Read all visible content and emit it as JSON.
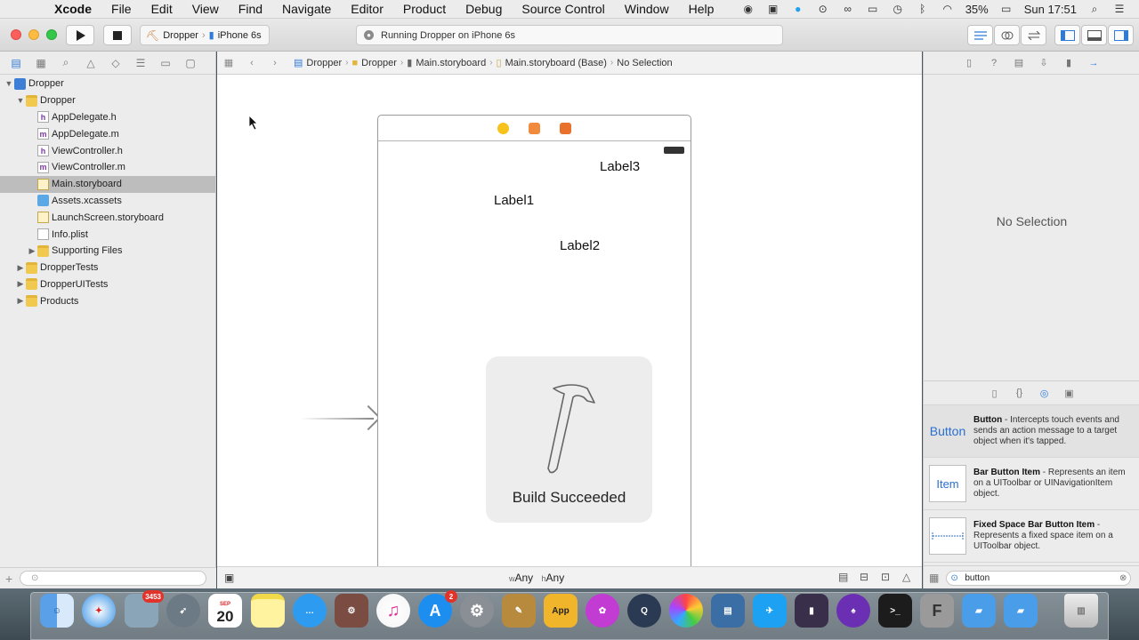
{
  "menubar": {
    "app_name": "Xcode",
    "items": [
      "File",
      "Edit",
      "View",
      "Find",
      "Navigate",
      "Editor",
      "Product",
      "Debug",
      "Source Control",
      "Window",
      "Help"
    ],
    "battery": "35%",
    "clock": "Sun 17:51"
  },
  "toolbar": {
    "scheme_name": "Dropper",
    "destination": "iPhone 6s",
    "activity_text": "Running Dropper on iPhone 6s"
  },
  "navigator": {
    "items": [
      {
        "label": "Dropper"
      },
      {
        "label": "Dropper"
      },
      {
        "label": "AppDelegate.h"
      },
      {
        "label": "AppDelegate.m"
      },
      {
        "label": "ViewController.h"
      },
      {
        "label": "ViewController.m"
      },
      {
        "label": "Main.storyboard"
      },
      {
        "label": "Assets.xcassets"
      },
      {
        "label": "LaunchScreen.storyboard"
      },
      {
        "label": "Info.plist"
      },
      {
        "label": "Supporting Files"
      },
      {
        "label": "DropperTests"
      },
      {
        "label": "DropperUITests"
      },
      {
        "label": "Products"
      }
    ]
  },
  "jumpbar": {
    "crumbs": [
      "Dropper",
      "Dropper",
      "Main.storyboard",
      "Main.storyboard (Base)",
      "No Selection"
    ]
  },
  "canvas": {
    "labels": [
      "Label3",
      "Label1",
      "Label2"
    ],
    "size_class_w": "Any",
    "size_class_h": "Any",
    "hud_text": "Build Succeeded"
  },
  "inspector": {
    "no_selection": "No Selection"
  },
  "library": {
    "items": [
      {
        "thumb": "Button",
        "title": "Button",
        "desc": " - Intercepts touch events and sends an action message to a target object when it's tapped."
      },
      {
        "thumb": "Item",
        "title": "Bar Button Item",
        "desc": " - Represents an item on a UIToolbar or UINavigationItem object."
      },
      {
        "thumb": "",
        "title": "Fixed Space Bar Button Item",
        "desc": " - Represents a fixed space item on a UIToolbar object."
      }
    ],
    "filter_value": "button"
  },
  "dock": {
    "badges": [
      "3453",
      "2"
    ],
    "calendar_day": "20",
    "calendar_month": "SEP",
    "app_store_label": "App"
  },
  "colors": {
    "accent": "#2f7bd8",
    "selection": "#bdbdbd",
    "close": "#fc605c",
    "minimize": "#fdbc40",
    "zoom": "#34c84a"
  }
}
